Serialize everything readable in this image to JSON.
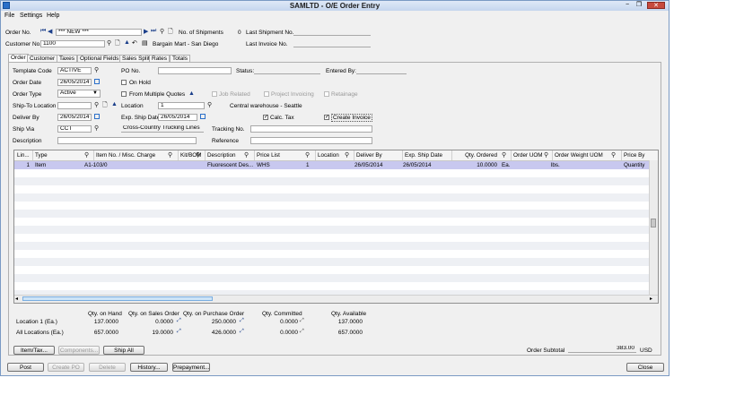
{
  "window": {
    "title": "SAMLTD - O/E Order Entry",
    "min": "−",
    "max": "❐",
    "close": "✕"
  },
  "menu": [
    "File",
    "Settings",
    "Help"
  ],
  "header": {
    "order_no_label": "Order No.",
    "order_no_value": "*** NEW ***",
    "no_shipments_label": "No. of Shipments",
    "no_shipments_value": "0",
    "last_shipment_label": "Last Shipment No.",
    "customer_no_label": "Customer No.",
    "customer_no_value": "1100",
    "customer_name": "Bargain Mart - San Diego",
    "last_invoice_label": "Last Invoice No."
  },
  "tabs": [
    "Order",
    "Customer",
    "Taxes",
    "Optional Fields",
    "Sales Split",
    "Rates",
    "Totals"
  ],
  "form": {
    "template_code_label": "Template Code",
    "template_code_value": "ACTIVE",
    "po_no_label": "PO No.",
    "status_label": "Status:",
    "entered_by_label": "Entered By:",
    "order_date_label": "Order Date",
    "order_date_value": "26/05/2014",
    "on_hold_label": "On Hold",
    "order_type_label": "Order Type",
    "order_type_value": "Active",
    "multiple_quotes_label": "From Multiple Quotes",
    "job_related_label": "Job Related",
    "project_invoicing_label": "Project Invoicing",
    "retainage_label": "Retainage",
    "ship_to_label": "Ship-To Location",
    "location_label": "Location",
    "location_value": "1",
    "location_desc": "Central warehouse - Seattle",
    "deliver_by_label": "Deliver By",
    "deliver_by_value": "26/05/2014",
    "exp_ship_label": "Exp. Ship Date",
    "exp_ship_value": "26/05/2014",
    "calc_tax_label": "Calc. Tax",
    "create_invoice_label": "Create Invoice",
    "ship_via_label": "Ship Via",
    "ship_via_value": "CCT",
    "ship_via_desc": "Cross-Country Trucking Lines",
    "tracking_label": "Tracking No.",
    "description_label": "Description",
    "reference_label": "Reference"
  },
  "grid": {
    "columns": [
      "Lin...",
      "Type",
      "Item No. / Misc. Charge",
      "Kit/BOM",
      "Description",
      "Price List",
      "Location",
      "Deliver By",
      "Exp. Ship Date",
      "Qty. Ordered",
      "Order UOM",
      "Order Weight UOM",
      "Price By"
    ],
    "rows": [
      {
        "line": "1",
        "type": "Item",
        "item": "A1-103/0",
        "kit": "",
        "description": "Fluorescent Des...",
        "price_list": "WHS",
        "location": "1",
        "deliver_by": "26/05/2014",
        "exp_ship": "26/05/2014",
        "qty": "10.0000",
        "uom": "Ea.",
        "weight_uom": "lbs.",
        "price_by": "Quantity"
      }
    ]
  },
  "stock": {
    "headers": [
      "Qty. on Hand",
      "Qty. on Sales Order",
      "Qty. on Purchase Order",
      "Qty. Committed",
      "Qty. Available"
    ],
    "rows": [
      {
        "label": "Location  1 (Ea.)",
        "on_hand": "137.0000",
        "on_so": "0.0000",
        "on_po": "250.0000",
        "committed": "0.0000",
        "available": "137.0000"
      },
      {
        "label": "All Locations (Ea.)",
        "on_hand": "657.0000",
        "on_so": "19.0000",
        "on_po": "426.0000",
        "committed": "0.0000",
        "available": "657.0000"
      }
    ]
  },
  "actions": {
    "item_tax": "Item/Tax...",
    "components": "Components...",
    "ship_all": "Ship All"
  },
  "subtotal": {
    "label": "Order Subtotal",
    "value": "383.00",
    "currency": "USD"
  },
  "footer": {
    "post": "Post",
    "create_po": "Create PO",
    "delete": "Delete",
    "history": "History...",
    "prepayment": "Prepayment...",
    "close": "Close"
  }
}
